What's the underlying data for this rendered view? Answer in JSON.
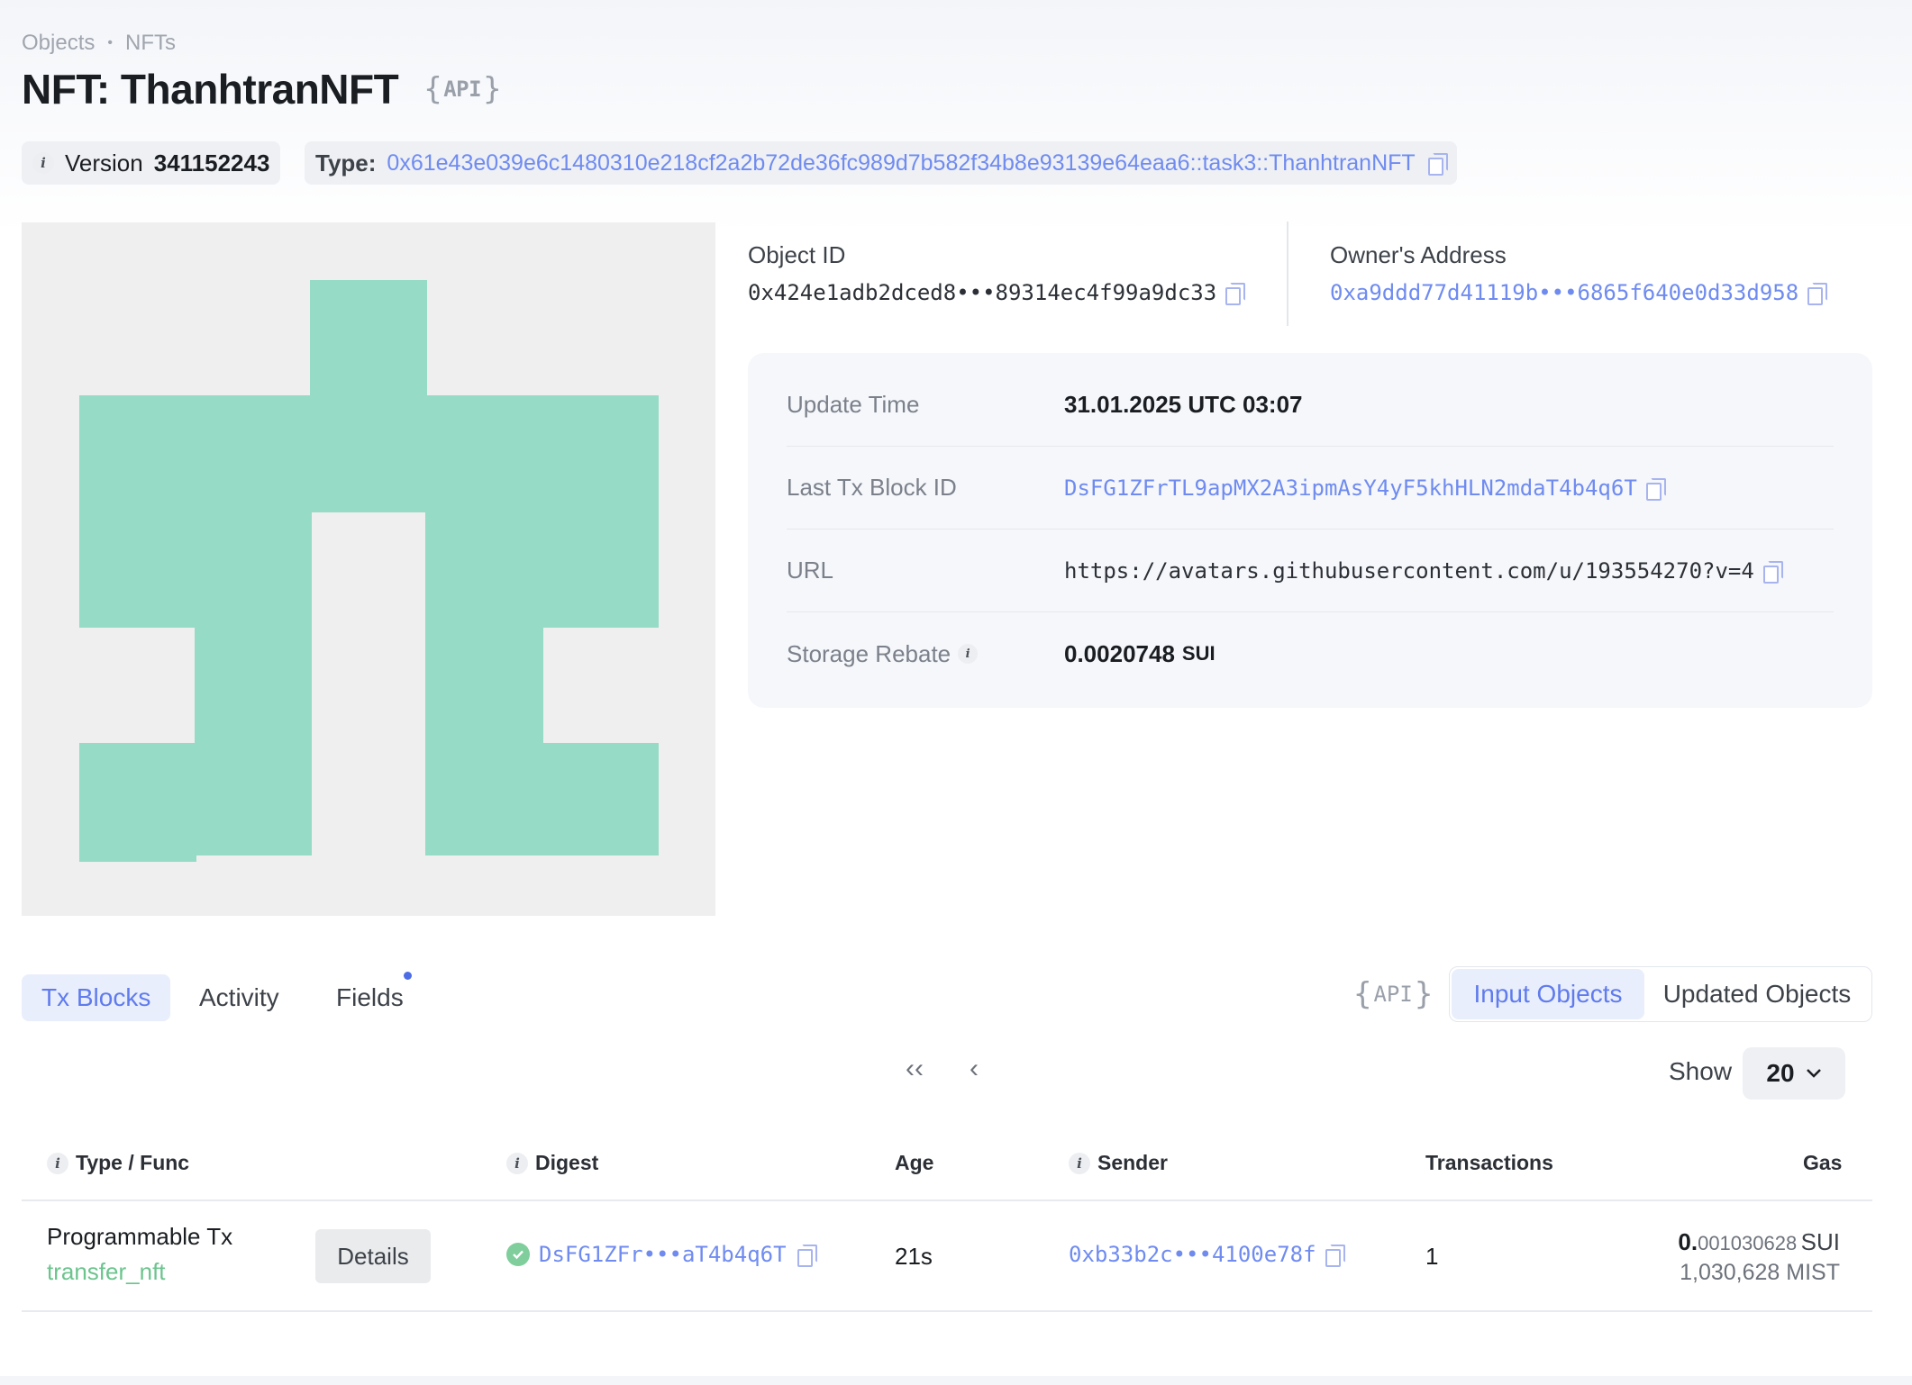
{
  "breadcrumb": {
    "items": [
      "Objects",
      "NFTs"
    ],
    "separator": "•"
  },
  "page": {
    "title": "NFT: ThanhtranNFT",
    "api_label": "API",
    "api_brace_open": "{",
    "api_brace_close": "}"
  },
  "version": {
    "label": "Version",
    "value": "341152243"
  },
  "type": {
    "label": "Type:",
    "value": "0x61e43e039e6c1480310e218cf2a2b72de36fc989d7b582f34b8e93139e64eaa6::task3::ThanhtranNFT"
  },
  "object": {
    "id_label": "Object ID",
    "id_value": "0x424e1adb2dced8•••89314ec4f99a9dc33",
    "owner_label": "Owner's Address",
    "owner_value": "0xa9ddd77d41119b•••6865f640e0d33d958"
  },
  "details": {
    "update_time_label": "Update Time",
    "update_time_value": "31.01.2025 UTC 03:07",
    "last_tx_label": "Last Tx Block ID",
    "last_tx_value": "DsFG1ZFrTL9apMX2A3ipmAsY4yF5khHLN2mdaT4b4q6T",
    "url_label": "URL",
    "url_value": "https://avatars.githubusercontent.com/u/193554270?v=4",
    "storage_label": "Storage Rebate",
    "storage_value": "0.0020748",
    "storage_unit": "SUI"
  },
  "nft_image": {
    "background": "#efefef",
    "fill": "#96dbc6"
  },
  "tabs": {
    "tx_blocks": "Tx Blocks",
    "activity": "Activity",
    "fields": "Fields"
  },
  "filter": {
    "api_label": "API",
    "input_objects": "Input Objects",
    "updated_objects": "Updated Objects"
  },
  "pagination": {
    "first": "‹‹",
    "prev": "‹",
    "show_label": "Show",
    "page_size": "20"
  },
  "table": {
    "headers": {
      "type_func": "Type / Func",
      "digest": "Digest",
      "age": "Age",
      "sender": "Sender",
      "transactions": "Transactions",
      "gas": "Gas"
    },
    "rows": [
      {
        "type": "Programmable Tx",
        "func": "transfer_nft",
        "details_label": "Details",
        "digest": "DsFG1ZFr•••aT4b4q6T",
        "age": "21s",
        "sender": "0xb33b2c•••4100e78f",
        "transactions": "1",
        "gas_int": "0.",
        "gas_frac": "001030628",
        "gas_unit": "SUI",
        "gas_mist": "1,030,628 MIST"
      }
    ]
  },
  "colors": {
    "accent": "#5f7bed",
    "link": "#6f8bf0",
    "success": "#7fce9c",
    "func": "#6cc48e"
  }
}
